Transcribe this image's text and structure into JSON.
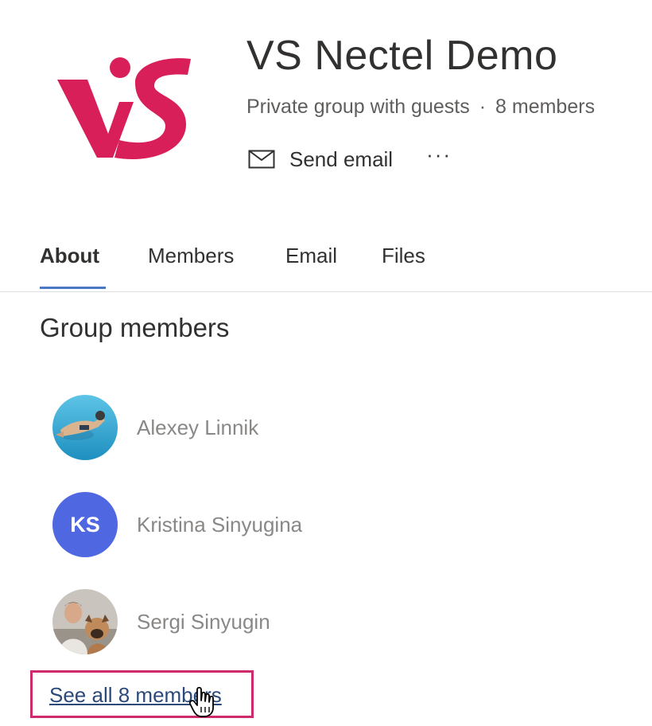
{
  "header": {
    "logo_icon": "vs-logo",
    "logo_color": "#d81f5a",
    "title": "VS Nectel Demo",
    "privacy": "Private group with guests",
    "separator": "·",
    "member_count": "8 members",
    "send_email_label": "Send email",
    "more_label": "···"
  },
  "tabs": [
    {
      "label": "About",
      "active": true
    },
    {
      "label": "Members",
      "active": false
    },
    {
      "label": "Email",
      "active": false
    },
    {
      "label": "Files",
      "active": false
    }
  ],
  "section": {
    "title": "Group members"
  },
  "members": [
    {
      "name": "Alexey Linnik",
      "avatar": "photo-swimmer"
    },
    {
      "name": "Kristina Sinyugina",
      "initials": "KS",
      "avatar_color": "#4f67e0"
    },
    {
      "name": "Sergi Sinyugin",
      "avatar": "photo-man-with-dog"
    }
  ],
  "see_all": {
    "label": "See all 8 members",
    "highlight_color": "#cf2a6b"
  },
  "accent_color": "#4a78c2"
}
